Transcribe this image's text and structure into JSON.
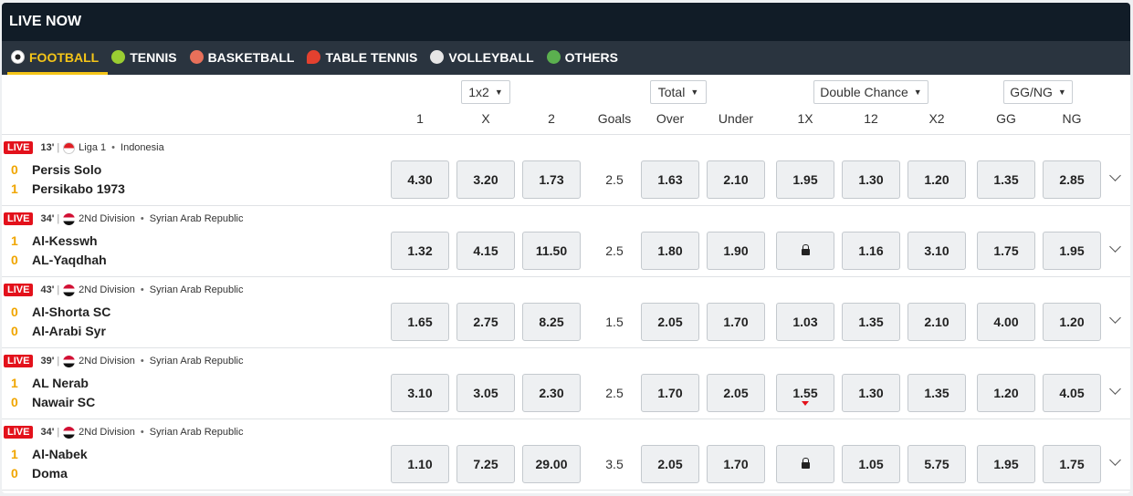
{
  "header": {
    "title": "LIVE NOW"
  },
  "tabs": [
    {
      "label": "FOOTBALL",
      "icon": "football-icon",
      "active": true
    },
    {
      "label": "TENNIS",
      "icon": "tennis-ball-icon"
    },
    {
      "label": "BASKETBALL",
      "icon": "basketball-icon"
    },
    {
      "label": "TABLE TENNIS",
      "icon": "table-tennis-icon"
    },
    {
      "label": "VOLLEYBALL",
      "icon": "volleyball-icon"
    },
    {
      "label": "OTHERS",
      "icon": "others-icon"
    }
  ],
  "market_selects": {
    "main": "1x2",
    "total": "Total",
    "double_chance": "Double Chance",
    "ggng": "GG/NG"
  },
  "columns": {
    "c1": "1",
    "cx": "X",
    "c2": "2",
    "goals": "Goals",
    "over": "Over",
    "under": "Under",
    "d1x": "1X",
    "d12": "12",
    "dx2": "X2",
    "gg": "GG",
    "ng": "NG"
  },
  "live_label": "LIVE",
  "colors": {
    "live_badge": "#e3111b",
    "accent": "#f5c518",
    "header_bg": "#111c27",
    "tabs_bg": "#2a343f"
  },
  "matches": [
    {
      "minute": "13'",
      "league": "Liga 1",
      "country": "Indonesia",
      "flag": "indonesia-flag-icon",
      "home": {
        "name": "Persis Solo",
        "score": "0"
      },
      "away": {
        "name": "Persikabo 1973",
        "score": "1"
      },
      "odds": {
        "o1": "4.30",
        "ox": "3.20",
        "o2": "1.73",
        "goals": "2.5",
        "over": "1.63",
        "under": "2.10",
        "d1x": "1.95",
        "d12": "1.30",
        "dx2": "1.20",
        "gg": "1.35",
        "ng": "2.85"
      }
    },
    {
      "minute": "34'",
      "league": "2Nd Division",
      "country": "Syrian Arab Republic",
      "flag": "syria-flag-icon",
      "home": {
        "name": "Al-Kesswh",
        "score": "1"
      },
      "away": {
        "name": "AL-Yaqdhah",
        "score": "0"
      },
      "odds": {
        "o1": "1.32",
        "ox": "4.15",
        "o2": "11.50",
        "goals": "2.5",
        "over": "1.80",
        "under": "1.90",
        "d1x": "",
        "d12": "1.16",
        "dx2": "3.10",
        "gg": "1.75",
        "ng": "1.95"
      },
      "locked": [
        "d1x"
      ]
    },
    {
      "minute": "43'",
      "league": "2Nd Division",
      "country": "Syrian Arab Republic",
      "flag": "syria-flag-icon",
      "home": {
        "name": "Al-Shorta SC",
        "score": "0"
      },
      "away": {
        "name": "Al-Arabi Syr",
        "score": "0"
      },
      "odds": {
        "o1": "1.65",
        "ox": "2.75",
        "o2": "8.25",
        "goals": "1.5",
        "over": "2.05",
        "under": "1.70",
        "d1x": "1.03",
        "d12": "1.35",
        "dx2": "2.10",
        "gg": "4.00",
        "ng": "1.20"
      }
    },
    {
      "minute": "39'",
      "league": "2Nd Division",
      "country": "Syrian Arab Republic",
      "flag": "syria-flag-icon",
      "home": {
        "name": "AL Nerab",
        "score": "1"
      },
      "away": {
        "name": "Nawair SC",
        "score": "0"
      },
      "odds": {
        "o1": "3.10",
        "ox": "3.05",
        "o2": "2.30",
        "goals": "2.5",
        "over": "1.70",
        "under": "2.05",
        "d1x": "1.55",
        "d12": "1.30",
        "dx2": "1.35",
        "gg": "1.20",
        "ng": "4.05"
      },
      "dropping": [
        "d1x"
      ]
    },
    {
      "minute": "34'",
      "league": "2Nd Division",
      "country": "Syrian Arab Republic",
      "flag": "syria-flag-icon",
      "home": {
        "name": "Al-Nabek",
        "score": "1"
      },
      "away": {
        "name": "Doma",
        "score": "0"
      },
      "odds": {
        "o1": "1.10",
        "ox": "7.25",
        "o2": "29.00",
        "goals": "3.5",
        "over": "2.05",
        "under": "1.70",
        "d1x": "",
        "d12": "1.05",
        "dx2": "5.75",
        "gg": "1.95",
        "ng": "1.75"
      },
      "locked": [
        "d1x"
      ]
    }
  ]
}
